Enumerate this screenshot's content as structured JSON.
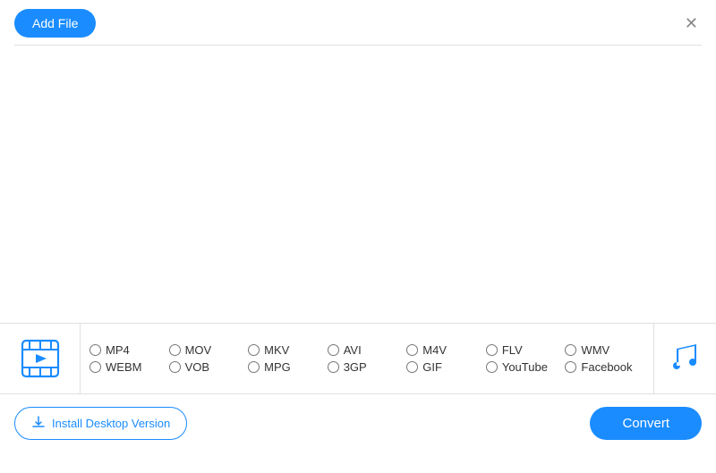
{
  "titleBar": {
    "addFileLabel": "Add File",
    "closeLabel": "✕"
  },
  "formats": {
    "row1": [
      {
        "id": "mp4",
        "label": "MP4"
      },
      {
        "id": "mov",
        "label": "MOV"
      },
      {
        "id": "mkv",
        "label": "MKV"
      },
      {
        "id": "avi",
        "label": "AVI"
      },
      {
        "id": "m4v",
        "label": "M4V"
      },
      {
        "id": "flv",
        "label": "FLV"
      },
      {
        "id": "wmv",
        "label": "WMV"
      }
    ],
    "row2": [
      {
        "id": "webm",
        "label": "WEBM"
      },
      {
        "id": "vob",
        "label": "VOB"
      },
      {
        "id": "mpg",
        "label": "MPG"
      },
      {
        "id": "3gp",
        "label": "3GP"
      },
      {
        "id": "gif",
        "label": "GIF"
      },
      {
        "id": "youtube",
        "label": "YouTube"
      },
      {
        "id": "facebook",
        "label": "Facebook"
      }
    ]
  },
  "bottomBar": {
    "installLabel": "Install Desktop Version",
    "convertLabel": "Convert"
  }
}
